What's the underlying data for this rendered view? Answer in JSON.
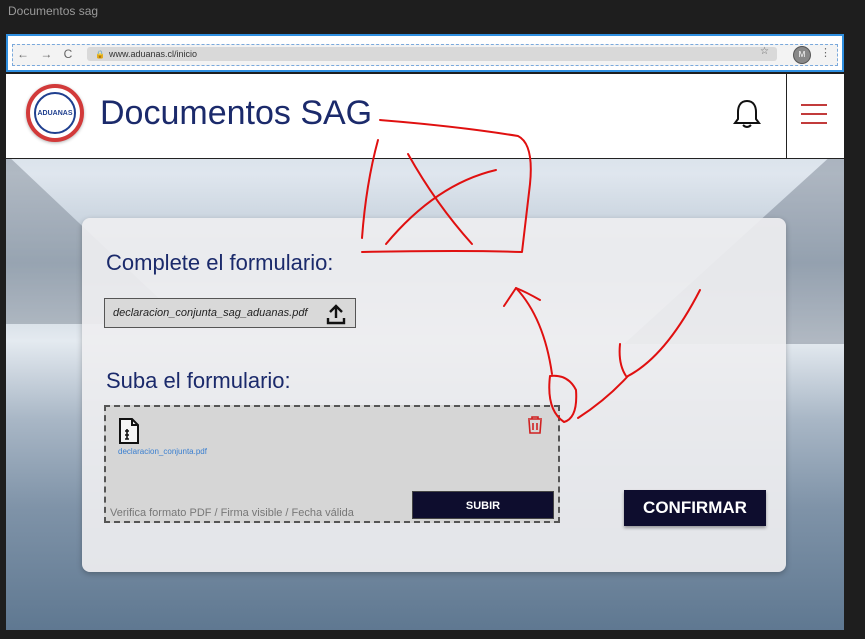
{
  "window": {
    "title": "Documentos sag"
  },
  "browser": {
    "nav": "← → C",
    "url": "www.aduanas.cl/inicio",
    "profile_initial": "M"
  },
  "header": {
    "logo_text": "ADUANAS",
    "title": "Documentos SAG"
  },
  "form": {
    "complete_title": "Complete el formulario:",
    "file_chip_name": "declaracion_conjunta_sag_aduanas.pdf",
    "upload_title": "Suba el formulario:",
    "uploaded_file_name": "declaracion_conjunta.pdf",
    "hint": "Verifica formato PDF / Firma visible / Fecha válida",
    "subir_label": "SUBIR",
    "confirm_label": "CONFIRMAR"
  },
  "colors": {
    "accent_navy": "#1b2a6b",
    "button_dark": "#0e0d2e",
    "annotation_red": "#e01010",
    "browser_focus": "#2f8fe0"
  }
}
